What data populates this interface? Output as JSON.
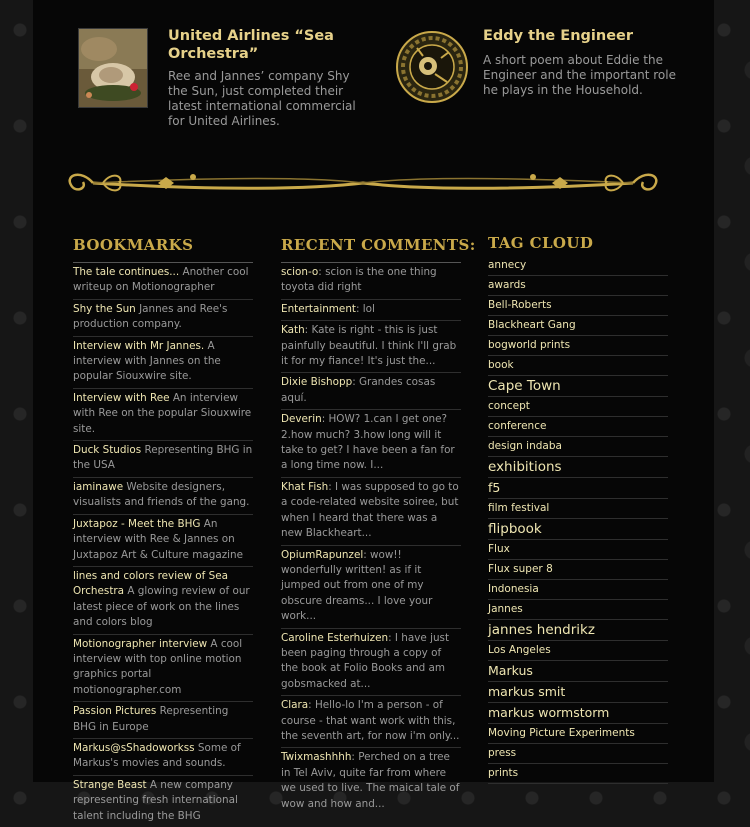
{
  "features": [
    {
      "title": "United Airlines “Sea Orchestra”",
      "description": "Ree and Jannes’ company Shy the Sun, just completed their latest international commercial for United Airlines."
    },
    {
      "title": "Eddy the Engineer",
      "description": "A short poem about Eddie the Engineer and the important role he plays in the Household."
    }
  ],
  "bookmarks": {
    "heading": "BOOKMARKS",
    "items": [
      {
        "link": "The tale continues...",
        "text": "Another cool writeup on Motionographer"
      },
      {
        "link": "Shy the Sun",
        "text": "Jannes and Ree's production company."
      },
      {
        "link": "Interview with Mr Jannes.",
        "text": "A interview with Jannes on the popular Siouxwire site."
      },
      {
        "link": "Interview with Ree",
        "text": "An interview with Ree on the popular Siouxwire site."
      },
      {
        "link": "Duck Studios",
        "text": "Representing BHG in the USA"
      },
      {
        "link": "iaminawe",
        "text": "Website designers, visualists and friends of the gang."
      },
      {
        "link": "Juxtapoz - Meet the BHG",
        "text": "An interview with Ree & Jannes on Juxtapoz Art & Culture magazine"
      },
      {
        "link": "lines and colors review of Sea Orchestra",
        "text": "A glowing review of our latest piece of work on the lines and colors blog"
      },
      {
        "link": "Motionographer interview",
        "text": "A cool interview with top online motion graphics portal motionographer.com"
      },
      {
        "link": "Passion Pictures",
        "text": "Representing BHG in Europe"
      },
      {
        "link": "Markus@sShadoworkss",
        "text": "Some of Markus's movies and sounds."
      },
      {
        "link": "Strange Beast",
        "text": "A new company representing fresh international talent including the BHG"
      }
    ]
  },
  "comments": {
    "heading": "RECENT COMMENTS:",
    "items": [
      {
        "author": "scion-o",
        "text": ": scion is the one thing toyota did right"
      },
      {
        "author": "Entertainment",
        "text": ": lol"
      },
      {
        "author": "Kath",
        "text": ": Kate is right - this is just painfully beautiful. I think I'll grab it for my fiance! It's just the..."
      },
      {
        "author": "Dixie Bishopp",
        "text": ": Grandes cosas aquí."
      },
      {
        "author": "Deverin",
        "text": ": HOW? 1.can I get one? 2.how much? 3.how long will it take to get? I have been a fan for a long time now. I..."
      },
      {
        "author": "Khat Fish",
        "text": ": I was supposed to go to a code-related website soiree, but when I heard that there was a new Blackheart..."
      },
      {
        "author": "OpiumRapunzel",
        "text": ": wow!! wonderfully written! as if it jumped out from one of my obscure dreams... I love your work..."
      },
      {
        "author": "Caroline Esterhuizen",
        "text": ": I have just been paging through a copy of the book at Folio Books and am gobsmacked at..."
      },
      {
        "author": "Clara",
        "text": ": Hello-lo I'm a person - of course - that want work with this, the seventh art, for now i'm only..."
      },
      {
        "author": "Twixmashhhh",
        "text": ": Perched on a tree in Tel Aviv, quite far from where we used to live. The maical tale of wow and how and..."
      }
    ]
  },
  "tagcloud": {
    "heading": "TAG CLOUD",
    "tags": [
      {
        "label": "annecy",
        "size": "sm"
      },
      {
        "label": "awards",
        "size": "sm"
      },
      {
        "label": "Bell-Roberts",
        "size": "sm"
      },
      {
        "label": "Blackheart Gang",
        "size": "sm"
      },
      {
        "label": "bogworld prints",
        "size": "sm"
      },
      {
        "label": "book",
        "size": "sm"
      },
      {
        "label": "Cape Town",
        "size": "lg"
      },
      {
        "label": "concept",
        "size": "sm"
      },
      {
        "label": "conference",
        "size": "sm"
      },
      {
        "label": "design indaba",
        "size": "sm"
      },
      {
        "label": "exhibitions",
        "size": "lg"
      },
      {
        "label": "f5",
        "size": "md"
      },
      {
        "label": "film festival",
        "size": "sm"
      },
      {
        "label": "flipbook",
        "size": "lg"
      },
      {
        "label": "Flux",
        "size": "sm"
      },
      {
        "label": "Flux super 8",
        "size": "sm"
      },
      {
        "label": "Indonesia",
        "size": "sm"
      },
      {
        "label": "Jannes",
        "size": "sm"
      },
      {
        "label": "jannes hendrikz",
        "size": "lg"
      },
      {
        "label": "Los Angeles",
        "size": "sm"
      },
      {
        "label": "Markus",
        "size": "md"
      },
      {
        "label": "markus smit",
        "size": "md"
      },
      {
        "label": "markus wormstorm",
        "size": "md"
      },
      {
        "label": "Moving Picture Experiments",
        "size": "sm"
      },
      {
        "label": "press",
        "size": "sm"
      },
      {
        "label": "prints",
        "size": "sm"
      }
    ]
  },
  "colors": {
    "accent": "#c9a94a",
    "link": "#efe6b2",
    "muted": "#9a9a9a",
    "background": "#060606"
  },
  "icons": [
    "snail-thumbnail",
    "gear-medallion-thumbnail",
    "ornamental-divider"
  ]
}
